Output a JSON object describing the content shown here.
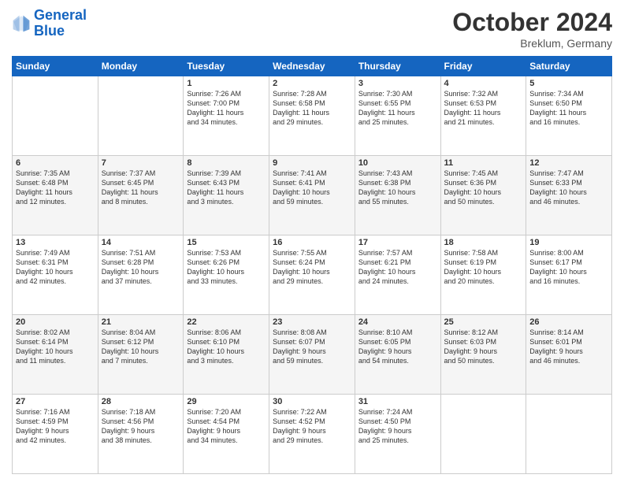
{
  "header": {
    "logo_line1": "General",
    "logo_line2": "Blue",
    "month": "October 2024",
    "location": "Breklum, Germany"
  },
  "days_of_week": [
    "Sunday",
    "Monday",
    "Tuesday",
    "Wednesday",
    "Thursday",
    "Friday",
    "Saturday"
  ],
  "weeks": [
    [
      {
        "day": "",
        "info": ""
      },
      {
        "day": "",
        "info": ""
      },
      {
        "day": "1",
        "info": "Sunrise: 7:26 AM\nSunset: 7:00 PM\nDaylight: 11 hours\nand 34 minutes."
      },
      {
        "day": "2",
        "info": "Sunrise: 7:28 AM\nSunset: 6:58 PM\nDaylight: 11 hours\nand 29 minutes."
      },
      {
        "day": "3",
        "info": "Sunrise: 7:30 AM\nSunset: 6:55 PM\nDaylight: 11 hours\nand 25 minutes."
      },
      {
        "day": "4",
        "info": "Sunrise: 7:32 AM\nSunset: 6:53 PM\nDaylight: 11 hours\nand 21 minutes."
      },
      {
        "day": "5",
        "info": "Sunrise: 7:34 AM\nSunset: 6:50 PM\nDaylight: 11 hours\nand 16 minutes."
      }
    ],
    [
      {
        "day": "6",
        "info": "Sunrise: 7:35 AM\nSunset: 6:48 PM\nDaylight: 11 hours\nand 12 minutes."
      },
      {
        "day": "7",
        "info": "Sunrise: 7:37 AM\nSunset: 6:45 PM\nDaylight: 11 hours\nand 8 minutes."
      },
      {
        "day": "8",
        "info": "Sunrise: 7:39 AM\nSunset: 6:43 PM\nDaylight: 11 hours\nand 3 minutes."
      },
      {
        "day": "9",
        "info": "Sunrise: 7:41 AM\nSunset: 6:41 PM\nDaylight: 10 hours\nand 59 minutes."
      },
      {
        "day": "10",
        "info": "Sunrise: 7:43 AM\nSunset: 6:38 PM\nDaylight: 10 hours\nand 55 minutes."
      },
      {
        "day": "11",
        "info": "Sunrise: 7:45 AM\nSunset: 6:36 PM\nDaylight: 10 hours\nand 50 minutes."
      },
      {
        "day": "12",
        "info": "Sunrise: 7:47 AM\nSunset: 6:33 PM\nDaylight: 10 hours\nand 46 minutes."
      }
    ],
    [
      {
        "day": "13",
        "info": "Sunrise: 7:49 AM\nSunset: 6:31 PM\nDaylight: 10 hours\nand 42 minutes."
      },
      {
        "day": "14",
        "info": "Sunrise: 7:51 AM\nSunset: 6:28 PM\nDaylight: 10 hours\nand 37 minutes."
      },
      {
        "day": "15",
        "info": "Sunrise: 7:53 AM\nSunset: 6:26 PM\nDaylight: 10 hours\nand 33 minutes."
      },
      {
        "day": "16",
        "info": "Sunrise: 7:55 AM\nSunset: 6:24 PM\nDaylight: 10 hours\nand 29 minutes."
      },
      {
        "day": "17",
        "info": "Sunrise: 7:57 AM\nSunset: 6:21 PM\nDaylight: 10 hours\nand 24 minutes."
      },
      {
        "day": "18",
        "info": "Sunrise: 7:58 AM\nSunset: 6:19 PM\nDaylight: 10 hours\nand 20 minutes."
      },
      {
        "day": "19",
        "info": "Sunrise: 8:00 AM\nSunset: 6:17 PM\nDaylight: 10 hours\nand 16 minutes."
      }
    ],
    [
      {
        "day": "20",
        "info": "Sunrise: 8:02 AM\nSunset: 6:14 PM\nDaylight: 10 hours\nand 11 minutes."
      },
      {
        "day": "21",
        "info": "Sunrise: 8:04 AM\nSunset: 6:12 PM\nDaylight: 10 hours\nand 7 minutes."
      },
      {
        "day": "22",
        "info": "Sunrise: 8:06 AM\nSunset: 6:10 PM\nDaylight: 10 hours\nand 3 minutes."
      },
      {
        "day": "23",
        "info": "Sunrise: 8:08 AM\nSunset: 6:07 PM\nDaylight: 9 hours\nand 59 minutes."
      },
      {
        "day": "24",
        "info": "Sunrise: 8:10 AM\nSunset: 6:05 PM\nDaylight: 9 hours\nand 54 minutes."
      },
      {
        "day": "25",
        "info": "Sunrise: 8:12 AM\nSunset: 6:03 PM\nDaylight: 9 hours\nand 50 minutes."
      },
      {
        "day": "26",
        "info": "Sunrise: 8:14 AM\nSunset: 6:01 PM\nDaylight: 9 hours\nand 46 minutes."
      }
    ],
    [
      {
        "day": "27",
        "info": "Sunrise: 7:16 AM\nSunset: 4:59 PM\nDaylight: 9 hours\nand 42 minutes."
      },
      {
        "day": "28",
        "info": "Sunrise: 7:18 AM\nSunset: 4:56 PM\nDaylight: 9 hours\nand 38 minutes."
      },
      {
        "day": "29",
        "info": "Sunrise: 7:20 AM\nSunset: 4:54 PM\nDaylight: 9 hours\nand 34 minutes."
      },
      {
        "day": "30",
        "info": "Sunrise: 7:22 AM\nSunset: 4:52 PM\nDaylight: 9 hours\nand 29 minutes."
      },
      {
        "day": "31",
        "info": "Sunrise: 7:24 AM\nSunset: 4:50 PM\nDaylight: 9 hours\nand 25 minutes."
      },
      {
        "day": "",
        "info": ""
      },
      {
        "day": "",
        "info": ""
      }
    ]
  ]
}
